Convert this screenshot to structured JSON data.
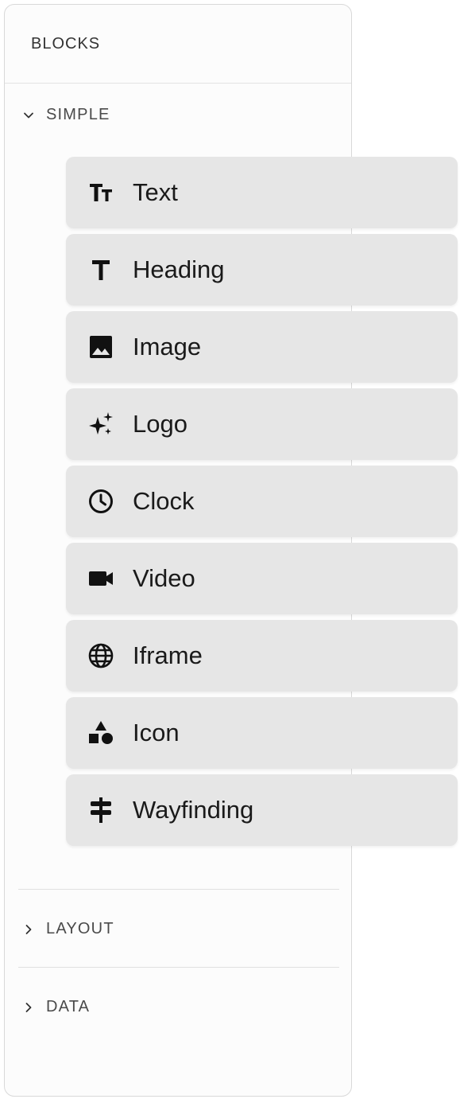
{
  "panel": {
    "title": "BLOCKS"
  },
  "sections": {
    "simple": {
      "label": "SIMPLE",
      "expanded": true
    },
    "layout": {
      "label": "LAYOUT",
      "expanded": false
    },
    "data": {
      "label": "DATA",
      "expanded": false
    }
  },
  "blocks": [
    {
      "label": "Text",
      "icon": "text-size-icon"
    },
    {
      "label": "Heading",
      "icon": "heading-icon"
    },
    {
      "label": "Image",
      "icon": "image-icon"
    },
    {
      "label": "Logo",
      "icon": "sparkles-icon"
    },
    {
      "label": "Clock",
      "icon": "clock-icon"
    },
    {
      "label": "Video",
      "icon": "video-camera-icon"
    },
    {
      "label": "Iframe",
      "icon": "globe-icon"
    },
    {
      "label": "Icon",
      "icon": "shapes-icon"
    },
    {
      "label": "Wayfinding",
      "icon": "signpost-icon"
    }
  ],
  "colors": {
    "block_bg": "#e6e6e6",
    "panel_border": "#d9d9d9",
    "text": "#1a1a1a"
  }
}
